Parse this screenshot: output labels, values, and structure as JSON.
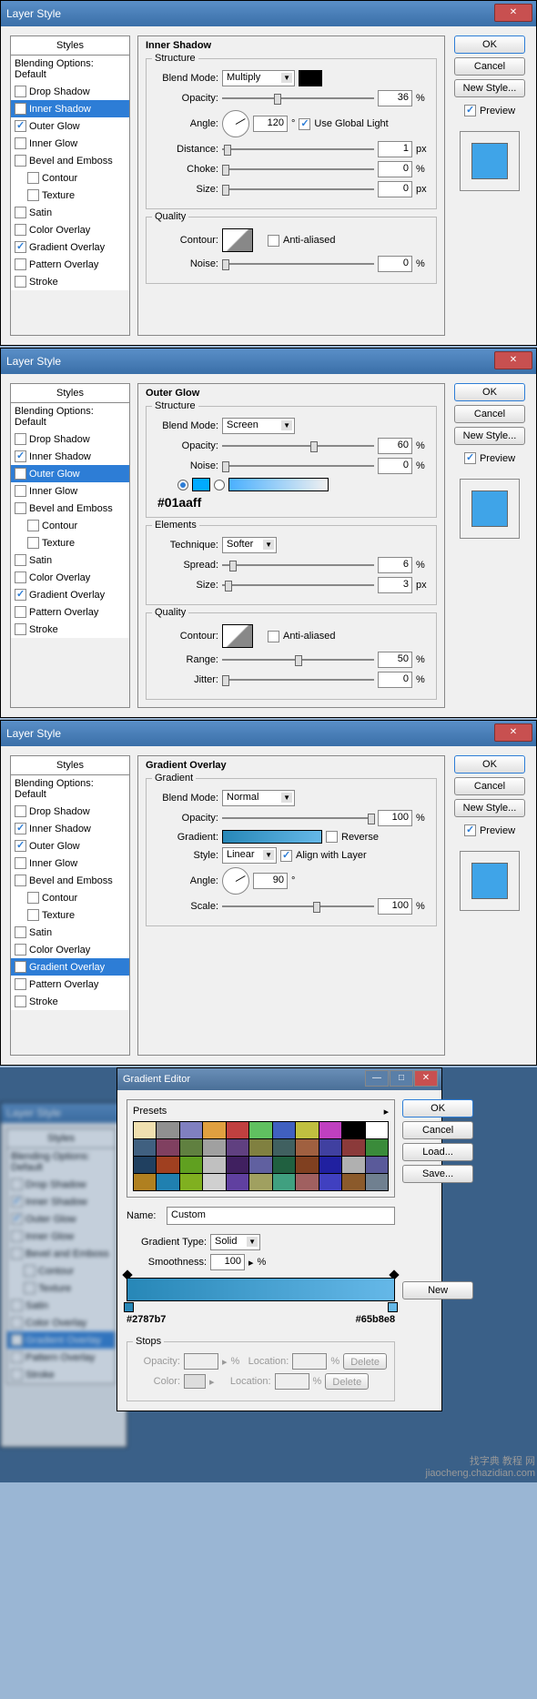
{
  "dlg_title": "Layer Style",
  "styles_header": "Styles",
  "blending_options": "Blending Options: Default",
  "style_names": {
    "drop_shadow": "Drop Shadow",
    "inner_shadow": "Inner Shadow",
    "outer_glow": "Outer Glow",
    "inner_glow": "Inner Glow",
    "bevel_emboss": "Bevel and Emboss",
    "contour": "Contour",
    "texture": "Texture",
    "satin": "Satin",
    "color_overlay": "Color Overlay",
    "gradient_overlay": "Gradient Overlay",
    "pattern_overlay": "Pattern Overlay",
    "stroke": "Stroke"
  },
  "buttons": {
    "ok": "OK",
    "cancel": "Cancel",
    "new_style": "New Style...",
    "preview": "Preview",
    "load": "Load...",
    "save": "Save...",
    "new": "New",
    "delete": "Delete"
  },
  "labels": {
    "structure": "Structure",
    "quality": "Quality",
    "elements": "Elements",
    "gradient_group": "Gradient",
    "blend_mode": "Blend Mode:",
    "opacity": "Opacity:",
    "angle": "Angle:",
    "distance": "Distance:",
    "choke": "Choke:",
    "size": "Size:",
    "contour": "Contour:",
    "noise": "Noise:",
    "anti_aliased": "Anti-aliased",
    "use_global_light": "Use Global Light",
    "technique": "Technique:",
    "spread": "Spread:",
    "range": "Range:",
    "jitter": "Jitter:",
    "gradient": "Gradient:",
    "style": "Style:",
    "scale": "Scale:",
    "reverse": "Reverse",
    "align_with_layer": "Align with Layer",
    "name": "Name:",
    "gradient_type": "Gradient Type:",
    "smoothness": "Smoothness:",
    "location": "Location:",
    "color": "Color:",
    "presets": "Presets",
    "stops": "Stops",
    "pct": "%",
    "px": "px",
    "deg": "°"
  },
  "panel1": {
    "title": "Inner Shadow",
    "blend_mode": "Multiply",
    "opacity": "36",
    "angle": "120",
    "use_global_light": true,
    "distance": "1",
    "choke": "0",
    "size": "0",
    "noise": "0",
    "checked": {
      "inner_shadow": true,
      "outer_glow": true,
      "gradient_overlay": true
    }
  },
  "panel2": {
    "title": "Outer Glow",
    "blend_mode": "Screen",
    "opacity": "60",
    "noise": "0",
    "color_hex": "#01aaff",
    "technique": "Softer",
    "spread": "6",
    "size": "3",
    "range": "50",
    "jitter": "0",
    "checked": {
      "inner_shadow": true,
      "outer_glow": true,
      "gradient_overlay": true
    }
  },
  "panel3": {
    "title": "Gradient Overlay",
    "blend_mode": "Normal",
    "opacity": "100",
    "reverse": false,
    "style": "Linear",
    "align_with_layer": true,
    "angle": "90",
    "scale": "100",
    "checked": {
      "inner_shadow": true,
      "outer_glow": true,
      "gradient_overlay": true
    }
  },
  "gradient_editor": {
    "title": "Gradient Editor",
    "name": "Custom",
    "type": "Solid",
    "smoothness": "100",
    "stop1": "#2787b7",
    "stop2": "#65b8e8",
    "preset_colors": [
      "#f0e0b0",
      "#909090",
      "#8080c0",
      "#e0a040",
      "#c04040",
      "#60c060",
      "#4060c0",
      "#c0c040",
      "#c040c0",
      "#000000",
      "#ffffff",
      "#406080",
      "#804060",
      "#608040",
      "#a0a0a0",
      "#604080",
      "#808040",
      "#406060",
      "#a06040",
      "#4040a0",
      "#8b3a3a",
      "#3a8b3a",
      "#204060",
      "#a04020",
      "#60a020",
      "#c0c0c0",
      "#402060",
      "#6060a0",
      "#206040",
      "#804020",
      "#2020a0",
      "#b0b0b0",
      "#5a5a9a",
      "#b08020",
      "#2080b0",
      "#80b020",
      "#d0d0d0",
      "#6040a0",
      "#a0a060",
      "#40a080",
      "#a06060",
      "#4040c0",
      "#8b5a2b",
      "#708090"
    ]
  },
  "watermark": {
    "line1": "找字典 教程 网",
    "line2": "jiaocheng.chazidian.com"
  }
}
